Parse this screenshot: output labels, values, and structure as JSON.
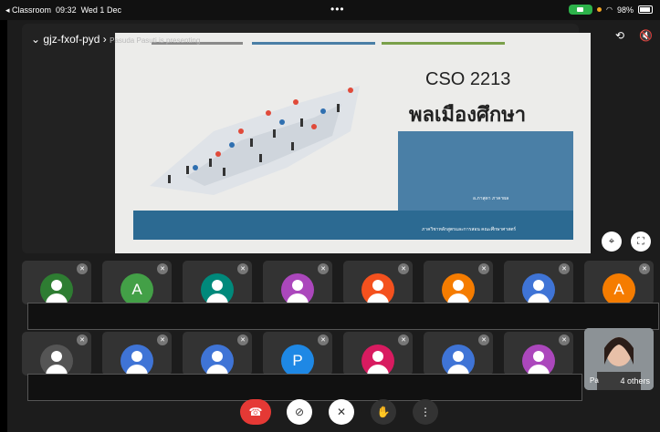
{
  "status_bar": {
    "app": "◂ Classroom",
    "time": "09:32",
    "date": "Wed 1 Dec",
    "more": "•••",
    "battery": "98%"
  },
  "meeting": {
    "code": "gjz-fxof-pyd",
    "presenter_overlay": "Pasuda Pasuti is presenting"
  },
  "slide": {
    "course": "CSO 2213",
    "title_thai": "พลเมืองศึกษา",
    "author": "อ.ภาสุดา ภาคาผล",
    "department": "ภาควิชาหลักสูตรและการสอน คณะศึกษาศาสตร์"
  },
  "participants_row1": [
    {
      "color": "#2e7d32",
      "letter": ""
    },
    {
      "color": "#43a047",
      "letter": "A"
    },
    {
      "color": "#00897b",
      "letter": ""
    },
    {
      "color": "#ab47bc",
      "letter": ""
    },
    {
      "color": "#f4511e",
      "letter": ""
    },
    {
      "color": "#f57c00",
      "letter": ""
    },
    {
      "color": "#3f74d6",
      "letter": ""
    },
    {
      "color": "#f57c00",
      "letter": "A"
    }
  ],
  "participants_row2": [
    {
      "color": "#555",
      "letter": ""
    },
    {
      "color": "#3f74d6",
      "letter": ""
    },
    {
      "color": "#3f74d6",
      "letter": ""
    },
    {
      "color": "#1e88e5",
      "letter": "P"
    },
    {
      "color": "#d81b60",
      "letter": ""
    },
    {
      "color": "#3f74d6",
      "letter": ""
    },
    {
      "color": "#ab47bc",
      "letter": ""
    }
  ],
  "self_tile": {
    "label": "Pa",
    "others": "4 others"
  },
  "icons": {
    "camera_switch": "camera-switch-icon",
    "speaker_off": "speaker-off-icon",
    "pin": "pin-icon",
    "fullscreen": "fullscreen-icon",
    "end_call": "end-call-icon",
    "video_off": "video-off-icon",
    "mic_off": "mic-off-icon",
    "raise_hand": "raise-hand-icon",
    "more": "more-vertical-icon"
  },
  "colors": {
    "end_call": "#e53935",
    "slide_blue": "#4a7fa6",
    "camera_pill": "#2db24a"
  }
}
